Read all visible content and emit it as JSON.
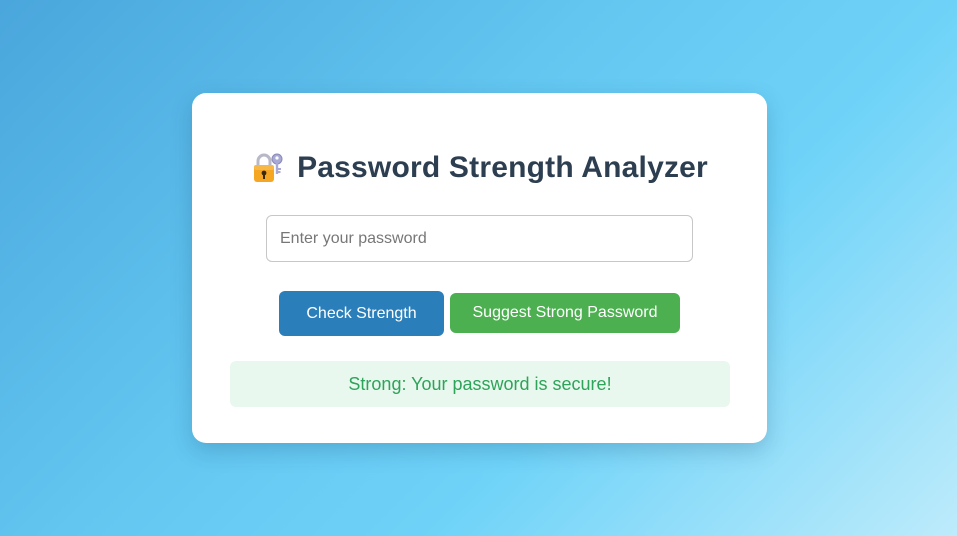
{
  "app": {
    "title": "Password Strength Analyzer",
    "title_icon": "locked-with-key-icon"
  },
  "password_input": {
    "value": "",
    "placeholder": "Enter your password"
  },
  "buttons": {
    "check_label": "Check Strength",
    "suggest_label": "Suggest Strong Password"
  },
  "result": {
    "text": "Strong: Your password is secure!"
  },
  "colors": {
    "title": "#2c3e50",
    "check_button": "#2a7fba",
    "suggest_button": "#4caf50",
    "result_text": "#2ea35a",
    "result_background": "#e8f8ee"
  }
}
